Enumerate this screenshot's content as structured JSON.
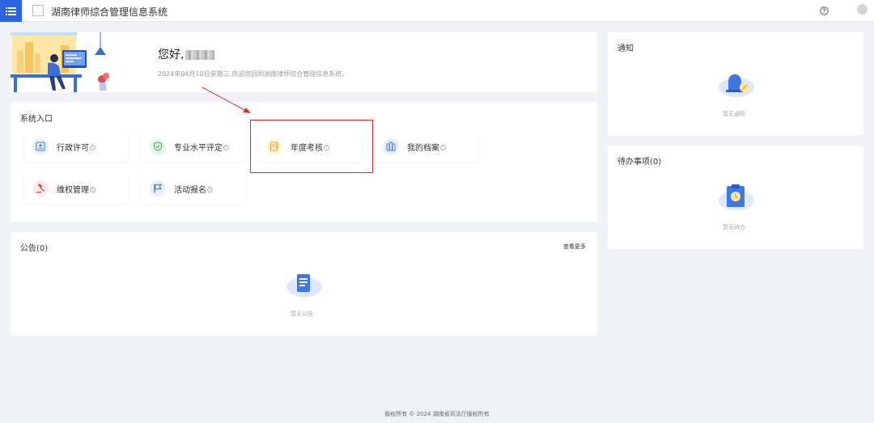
{
  "header": {
    "app_title": "湖南律师综合管理信息系统"
  },
  "welcome": {
    "greeting": "您好,",
    "subtitle": "2024年04月10日星期三,欢迎您回到湖南律师综合管理信息系统。"
  },
  "system_entry": {
    "title": "系统入口",
    "items": [
      {
        "label": "行政许可",
        "icon": "license-icon",
        "color": "#4a7fe5"
      },
      {
        "label": "专业水平评定",
        "icon": "shield-check-icon",
        "color": "#3fb554"
      },
      {
        "label": "年度考核",
        "icon": "assessment-doc-icon",
        "color": "#f0a020"
      },
      {
        "label": "我的档案",
        "icon": "archive-icon",
        "color": "#4a7fe5"
      },
      {
        "label": "维权管理",
        "icon": "gavel-icon",
        "color": "#e5484d"
      },
      {
        "label": "活动报名",
        "icon": "flag-icon",
        "color": "#2a6bd6"
      }
    ]
  },
  "announcements": {
    "title": "公告(0)",
    "more_label": "查看更多",
    "empty_text": "暂无公告"
  },
  "notifications": {
    "title": "通知",
    "empty_text": "暂无通知"
  },
  "todos": {
    "title": "待办事项(0)",
    "empty_text": "暂无待办"
  },
  "footer": {
    "copyright": "版权所有 © 2024 湖南省司法厅版权所有"
  },
  "colors": {
    "brand": "#2c64e0",
    "highlight": "#e03131",
    "background": "#f0f2f5"
  }
}
